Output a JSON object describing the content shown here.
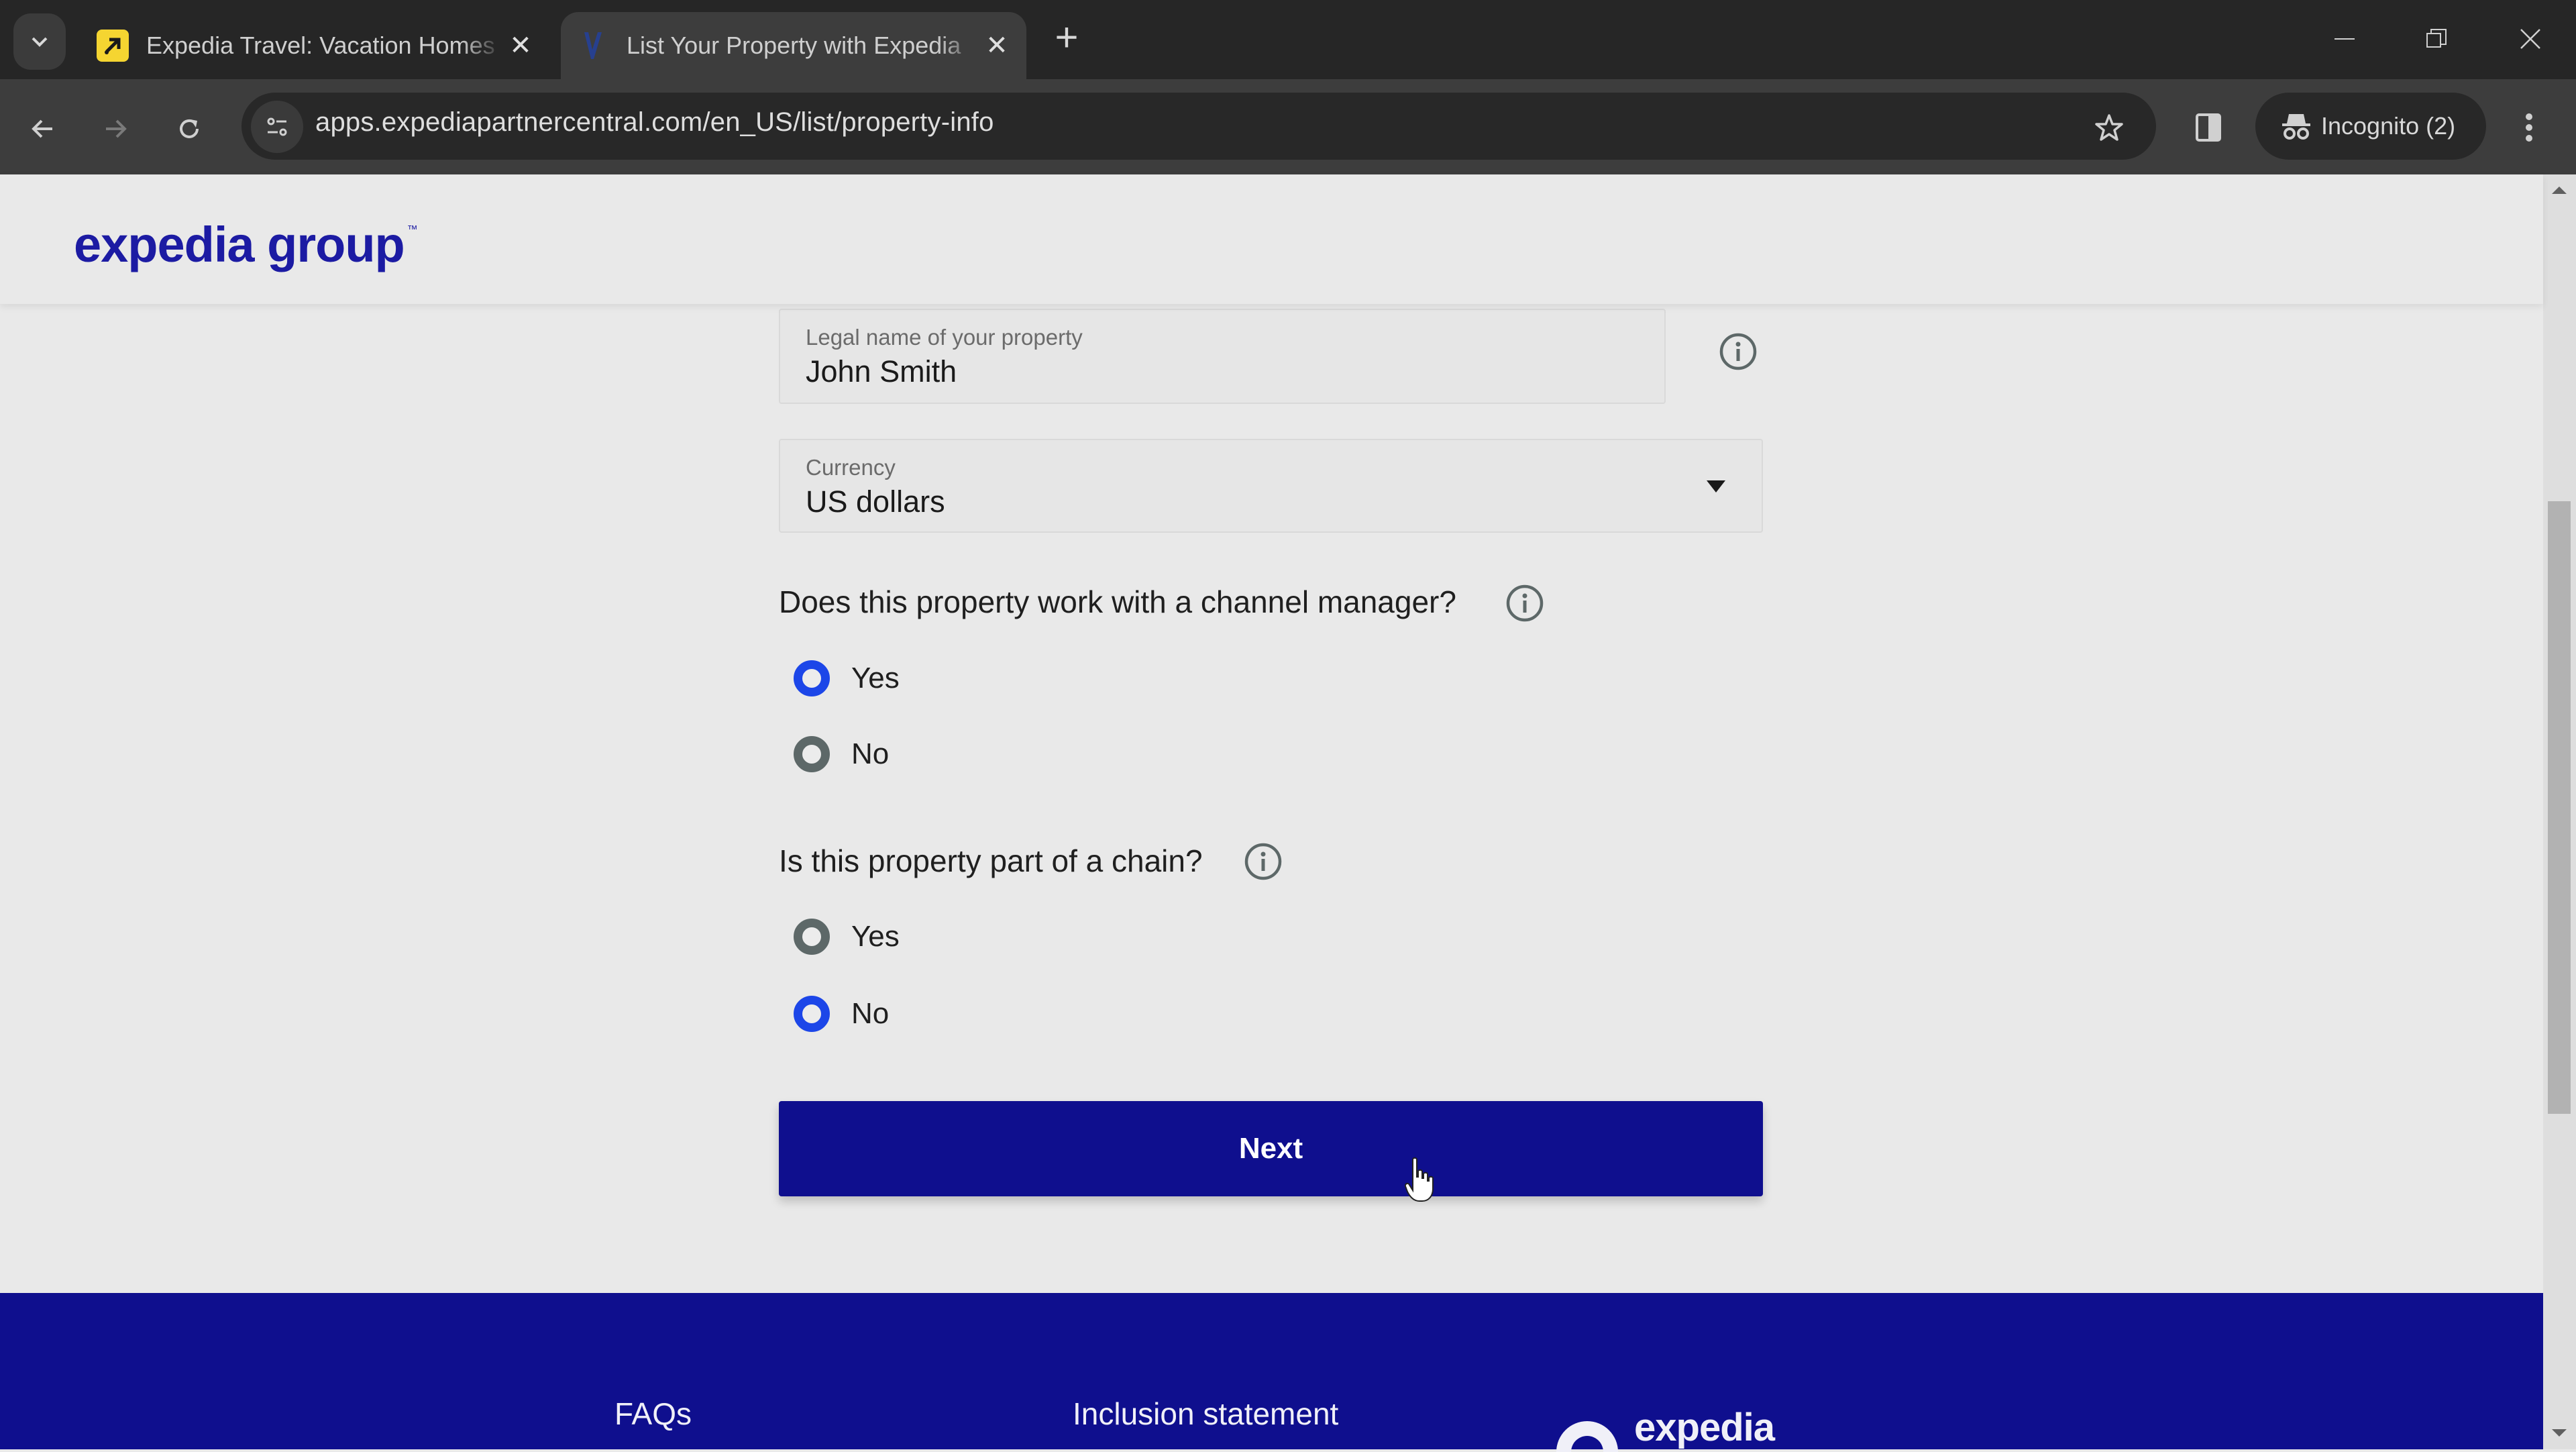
{
  "browser": {
    "tabs": [
      {
        "title": "Expedia Travel: Vacation Homes",
        "favicon": "expedia-travel-icon",
        "active": false,
        "favicon_color": "#f5d531"
      },
      {
        "title": "List Your Property with Expedia",
        "favicon": "expedia-group-icon",
        "active": true,
        "favicon_color": "#27408f"
      }
    ],
    "new_tab_label": "+",
    "close_glyph": "✕",
    "url": "apps.expediapartnercentral.com/en_US/list/property-info",
    "incognito_label": "Incognito (2)"
  },
  "site": {
    "logo_text": "expedia group",
    "logo_tm": "™",
    "brand_color": "#1c1ba3"
  },
  "form": {
    "legal_name": {
      "label": "Legal name of your property",
      "value": "John Smith"
    },
    "currency": {
      "label": "Currency",
      "value": "US dollars"
    },
    "channel_manager": {
      "question": "Does this property work with a channel manager?",
      "options": [
        {
          "label": "Yes",
          "checked": true
        },
        {
          "label": "No",
          "checked": false
        }
      ]
    },
    "chain": {
      "question": "Is this property part of a chain?",
      "options": [
        {
          "label": "Yes",
          "checked": false
        },
        {
          "label": "No",
          "checked": true
        }
      ]
    },
    "next_label": "Next",
    "accent_color": "#1c46e8",
    "button_color": "#0f0f8e"
  },
  "footer": {
    "links": [
      "FAQs",
      "Inclusion statement"
    ],
    "logo_text": "expedia"
  }
}
